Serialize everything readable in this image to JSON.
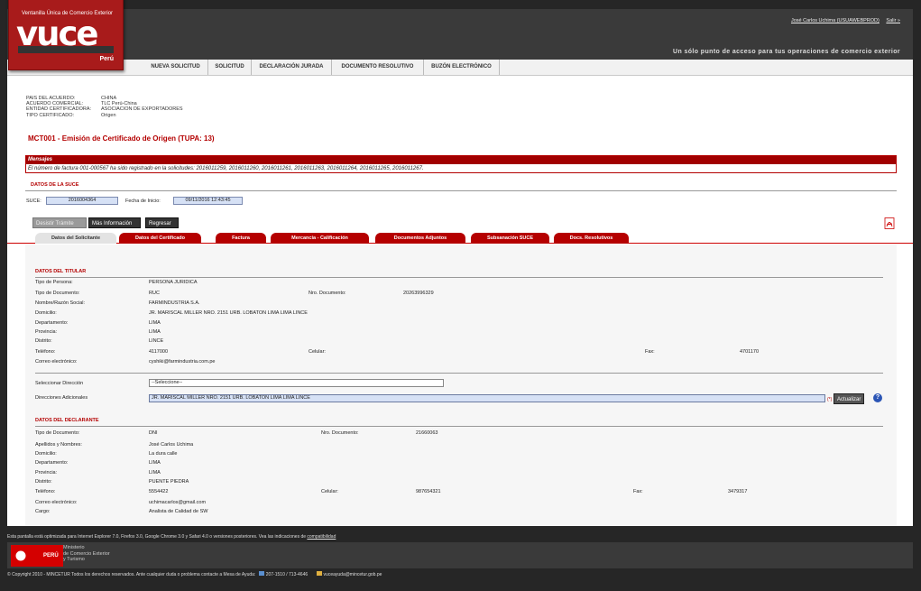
{
  "header": {
    "logo_small": "Ventanilla Única de Comercio Exterior",
    "logo_big": "vuce",
    "logo_country": "Perú",
    "user": "José Carlos Uchima (USUAWEBPROD)",
    "logout": "Salir »",
    "slogan": "Un sólo punto de acceso para tus operaciones de comercio exterior"
  },
  "nav": [
    "NUEVA SOLICITUD",
    "SOLICITUD",
    "DECLARACIÓN JURADA",
    "DOCUMENTO RESOLUTIVO",
    "BUZÓN ELECTRÓNICO"
  ],
  "agreement": {
    "rows": [
      {
        "k": "PAIS DEL ACUERDO:",
        "v": "CHINA"
      },
      {
        "k": "ACUERDO COMERCIAL:",
        "v": "TLC Perú-China"
      },
      {
        "k": "ENTIDAD CERTIFICADORA:",
        "v": "ASOCIACION DE EXPORTADORES"
      },
      {
        "k": "TIPO CERTIFICADO:",
        "v": "Origen"
      }
    ]
  },
  "page_title": "MCT001 - Emisión de Certificado de Origen (TUPA: 13)",
  "messages": {
    "header": "Mensajes",
    "text": "El número de factura 001-000567 ha sido registrado en la solicitudes: 2016011259, 2016011260, 2016011261, 2016011263, 2016011264, 2016011265, 2016011267."
  },
  "suce": {
    "section": "DATOS DE LA SUCE",
    "suce_label": "SUCE:",
    "suce_value": "2016004364",
    "date_label": "Fecha de Inicio:",
    "date_value": "09/11/2016 12:43:45"
  },
  "buttons": {
    "desistir": "Desistir Trámite",
    "mas_info": "Más Información",
    "regresar": "Regresar",
    "actualizar": "Actualizar"
  },
  "tabs": [
    "Datos del Solicitante",
    "Datos del Certificado",
    "Factura",
    "Mercancía - Calificación",
    "Documentos Adjuntos",
    "Subsanación SUCE",
    "Docs. Resolutivos"
  ],
  "titular": {
    "section": "DATOS DEL TITULAR",
    "tipo_persona_l": "Tipo de Persona:",
    "tipo_persona": "PERSONA JURIDICA",
    "tipo_doc_l": "Tipo de Documento:",
    "tipo_doc": "RUC",
    "nro_doc_l": "Nro. Documento:",
    "nro_doc": "20263996329",
    "nombre_l": "Nombre/Razón Social:",
    "nombre": "FARMINDUSTRIA S.A.",
    "domicilio_l": "Domicilio:",
    "domicilio": "JR. MARISCAL MILLER NRO. 2151 URB. LOBATON LIMA LIMA LINCE",
    "depto_l": "Departamento:",
    "depto": "LIMA",
    "prov_l": "Provincia:",
    "prov": "LIMA",
    "dist_l": "Distrito:",
    "dist": "LINCE",
    "tel_l": "Teléfono:",
    "tel": "4117000",
    "cel_l": "Celular:",
    "fax_l": "Fax:",
    "fax": "4701170",
    "email_l": "Correo electrónico:",
    "email": "cyshiki@farmindustria.com.pe",
    "sel_dir_l": "Seleccionar Dirección",
    "sel_dir": "--Seleccione--",
    "dir_ad_l": "Direcciones Adicionales",
    "dir_ad": "JR. MARISCAL MILLER NRO. 2151 URB. LOBATON LIMA LIMA LINCE",
    "q": "(*)"
  },
  "declarante": {
    "section": "DATOS DEL DECLARANTE",
    "tipo_doc_l": "Tipo de Documento:",
    "tipo_doc": "DNI",
    "nro_doc_l": "Nro. Documento:",
    "nro_doc": "21660063",
    "nombres_l": "Apellidos y Nombres:",
    "nombres": "José Carlos Uchima",
    "domicilio_l": "Domicilio:",
    "domicilio": "La dura calle",
    "depto_l": "Departamento:",
    "depto": "LIMA",
    "prov_l": "Provincia:",
    "prov": "LIMA",
    "dist_l": "Distrito:",
    "dist": "PUENTE PIEDRA",
    "tel_l": "Teléfono:",
    "tel": "5554422",
    "cel_l": "Celular:",
    "cel": "987654321",
    "fax_l": "Fax:",
    "fax": "3479317",
    "email_l": "Correo electrónico:",
    "email": "uchimacarlos@gmail.com",
    "cargo_l": "Cargo:",
    "cargo": "Analista de Calidad de SW"
  },
  "footer": {
    "note": "Esta pantalla está optimizada para Internet Explorer 7.0, Firefox 3.0, Google Chrome 3.0 y Safari 4.0 o versiones posteriores. Vea las indicaciones de",
    "note_link": "compatibilidad",
    "peru": "PERÚ",
    "ministry": [
      "Ministerio",
      "de Comercio Exterior",
      "y Turismo"
    ],
    "copyright": "© Copyright 2010 - MINCETUR Todos los derechos reservados. Ante cualquier duda o problema contacte a Mesa de Ayuda:",
    "phone": "207-1510 / 713-4646",
    "email": "vuceayuda@mincetur.gob.pe"
  }
}
